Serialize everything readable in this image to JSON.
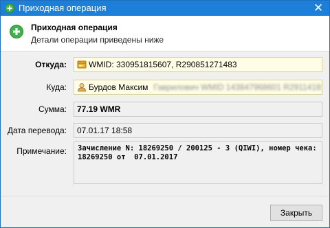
{
  "window": {
    "title": "Приходная операция",
    "close_glyph": "✕",
    "title_icon": "green-plus-icon"
  },
  "header": {
    "title": "Приходная операция",
    "subtitle": "Детали операции приведены ниже",
    "icon": "green-plus-icon"
  },
  "fields": {
    "from": {
      "label": "Откуда:",
      "value": "WMID: 330951815607, R290851271483",
      "icon": "wallet-icon"
    },
    "to": {
      "label": "Куда:",
      "name": "Бурдов Максим",
      "icon": "user-icon"
    },
    "amount": {
      "label": "Сумма:",
      "value": "77.19 WMR"
    },
    "date": {
      "label": "Дата перевода:",
      "value": "07.01.17 18:58"
    },
    "note": {
      "label": "Примечание:",
      "line1": "Зачисление N: 18269250 / 200125 - 3 (QIWI), номер чека:",
      "line2": "18269250 от  07.01.2017"
    }
  },
  "buttons": {
    "close": "Закрыть"
  },
  "colors": {
    "titlebar": "#1e7fd8",
    "highlight_field": "#fffde6",
    "background": "#f0f0f0"
  }
}
